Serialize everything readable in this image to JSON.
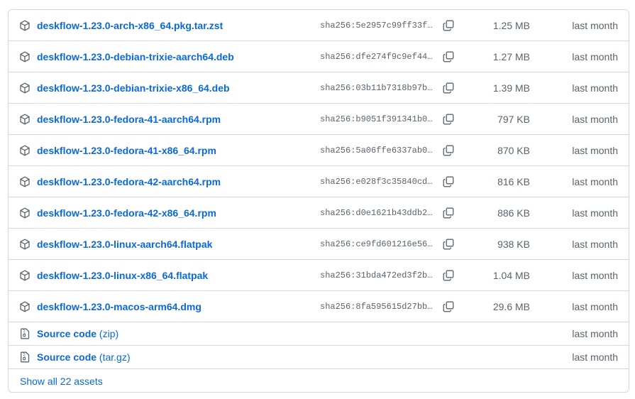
{
  "assets": [
    {
      "name": "deskflow-1.23.0-arch-x86_64.pkg.tar.zst",
      "sha": "sha256:5e2957c99ff33f…",
      "size": "1.25 MB",
      "date": "last month"
    },
    {
      "name": "deskflow-1.23.0-debian-trixie-aarch64.deb",
      "sha": "sha256:dfe274f9c9ef44…",
      "size": "1.27 MB",
      "date": "last month"
    },
    {
      "name": "deskflow-1.23.0-debian-trixie-x86_64.deb",
      "sha": "sha256:03b11b7318b97b…",
      "size": "1.39 MB",
      "date": "last month"
    },
    {
      "name": "deskflow-1.23.0-fedora-41-aarch64.rpm",
      "sha": "sha256:b9051f391341b0…",
      "size": "797 KB",
      "date": "last month"
    },
    {
      "name": "deskflow-1.23.0-fedora-41-x86_64.rpm",
      "sha": "sha256:5a06ffe6337ab0…",
      "size": "870 KB",
      "date": "last month"
    },
    {
      "name": "deskflow-1.23.0-fedora-42-aarch64.rpm",
      "sha": "sha256:e028f3c35840cd…",
      "size": "816 KB",
      "date": "last month"
    },
    {
      "name": "deskflow-1.23.0-fedora-42-x86_64.rpm",
      "sha": "sha256:d0e1621b43ddb2…",
      "size": "886 KB",
      "date": "last month"
    },
    {
      "name": "deskflow-1.23.0-linux-aarch64.flatpak",
      "sha": "sha256:ce9fd601216e56…",
      "size": "938 KB",
      "date": "last month"
    },
    {
      "name": "deskflow-1.23.0-linux-x86_64.flatpak",
      "sha": "sha256:31bda472ed3f2b…",
      "size": "1.04 MB",
      "date": "last month"
    },
    {
      "name": "deskflow-1.23.0-macos-arm64.dmg",
      "sha": "sha256:8fa595615d27bb…",
      "size": "29.6 MB",
      "date": "last month"
    }
  ],
  "source": [
    {
      "label": "Source code",
      "suffix": "(zip)",
      "date": "last month"
    },
    {
      "label": "Source code",
      "suffix": "(tar.gz)",
      "date": "last month"
    }
  ],
  "show_all_label": "Show all 22 assets",
  "colors": {
    "link": "#0969da",
    "muted": "#59636e",
    "border": "#d1d9e0"
  },
  "icons": {
    "asset": "package-icon",
    "copy": "copy-icon",
    "source": "file-zip-icon"
  }
}
